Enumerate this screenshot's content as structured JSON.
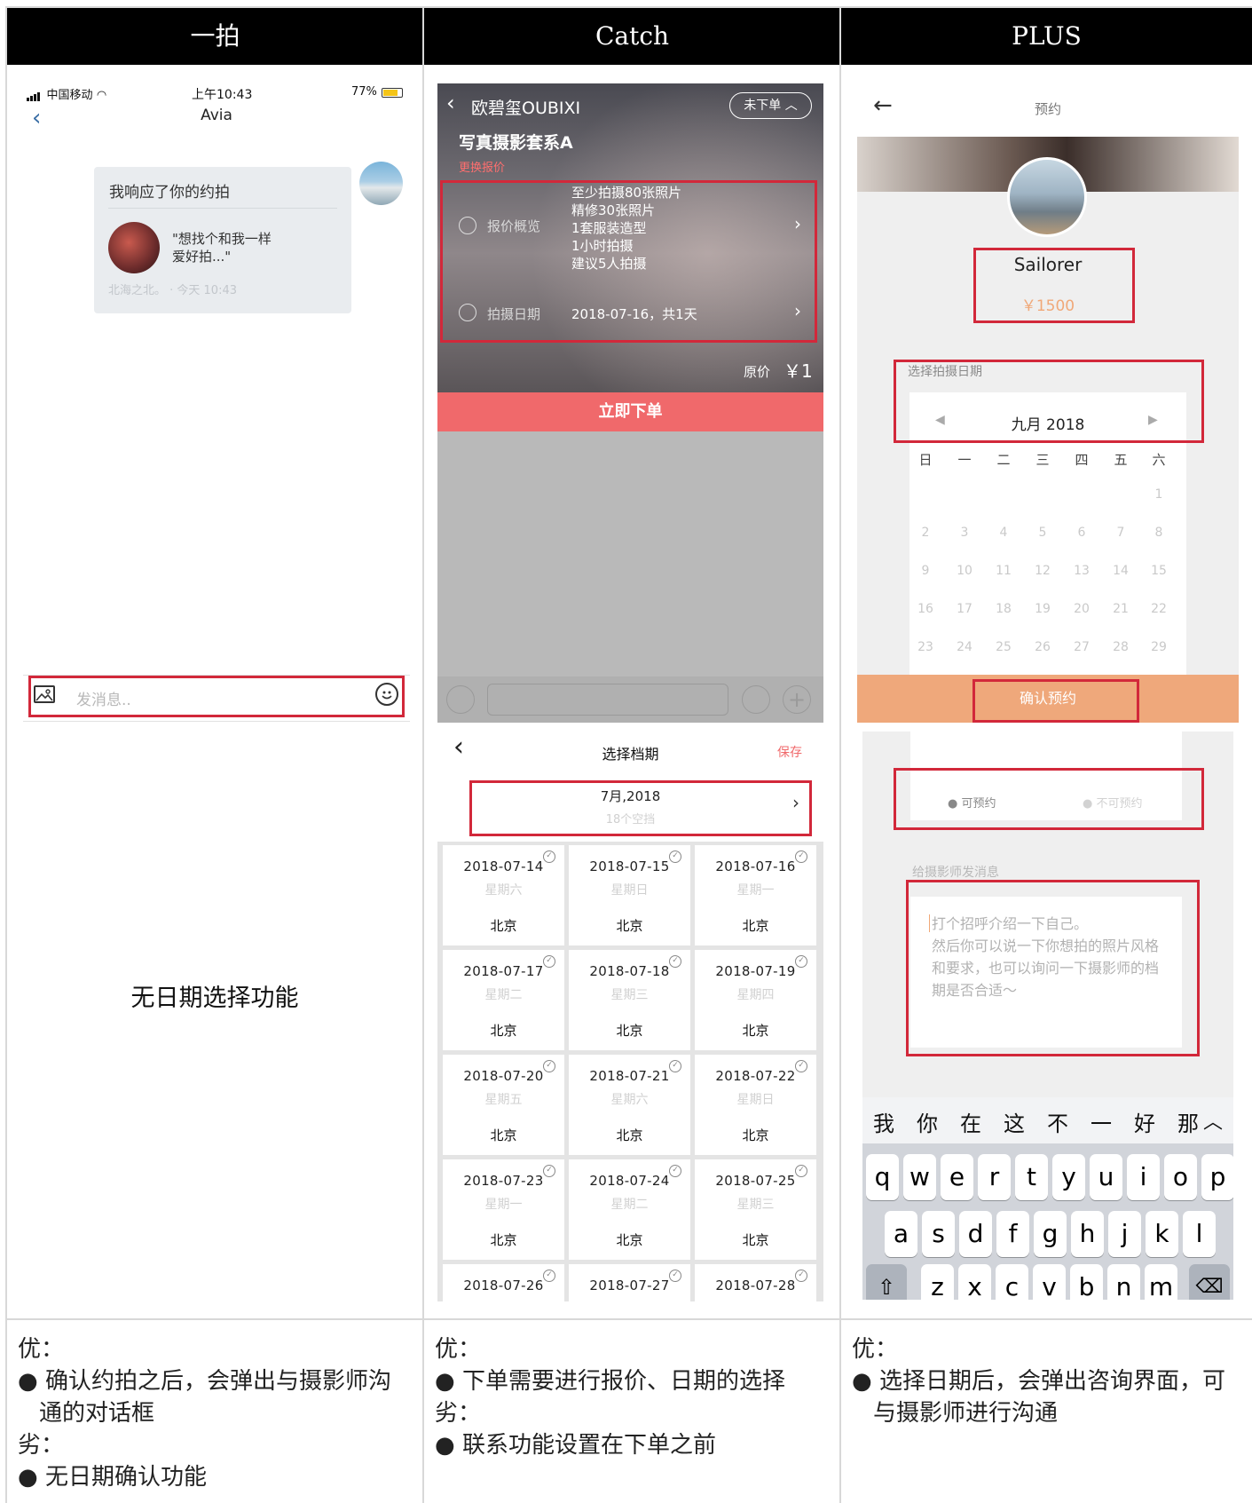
{
  "headers": [
    "一拍",
    "Catch",
    "PLUS"
  ],
  "panel1": {
    "status": {
      "carrier": "中国移动",
      "time": "上午10:43",
      "battery": "77%"
    },
    "nav_title": "Avia",
    "bubble_title": "我响应了你的约拍",
    "card_line1": "\"想找个和我一样",
    "card_line2": "爱好拍...\"",
    "meta": "北海之北。 · 今天 10:43",
    "input_placeholder": "发消息..",
    "no_date_note": "无日期选择功能"
  },
  "panel2": {
    "shop_name": "欧碧玺OUBIXI",
    "order_status": "未下单",
    "package_title": "写真摄影套系A",
    "change_quote": "更换报价",
    "overview_label": "报价概览",
    "overview_lines": [
      "至少拍摄80张照片",
      "精修30张照片",
      "1套服装造型",
      "1小时拍摄",
      "建议5人拍摄"
    ],
    "date_label": "拍摄日期",
    "date_value": "2018-07-16，共1天",
    "price_label": "原价",
    "price_value": "￥1",
    "order_button": "立即下单",
    "schedule_title": "选择档期",
    "save": "保存",
    "month": "7月,2018",
    "free_slots": "18个空挡",
    "dates": [
      {
        "date": "2018-07-14",
        "weekday": "星期六",
        "city": "北京"
      },
      {
        "date": "2018-07-15",
        "weekday": "星期日",
        "city": "北京"
      },
      {
        "date": "2018-07-16",
        "weekday": "星期一",
        "city": "北京"
      },
      {
        "date": "2018-07-17",
        "weekday": "星期二",
        "city": "北京"
      },
      {
        "date": "2018-07-18",
        "weekday": "星期三",
        "city": "北京"
      },
      {
        "date": "2018-07-19",
        "weekday": "星期四",
        "city": "北京"
      },
      {
        "date": "2018-07-20",
        "weekday": "星期五",
        "city": "北京"
      },
      {
        "date": "2018-07-21",
        "weekday": "星期六",
        "city": "北京"
      },
      {
        "date": "2018-07-22",
        "weekday": "星期日",
        "city": "北京"
      },
      {
        "date": "2018-07-23",
        "weekday": "星期一",
        "city": "北京"
      },
      {
        "date": "2018-07-24",
        "weekday": "星期二",
        "city": "北京"
      },
      {
        "date": "2018-07-25",
        "weekday": "星期三",
        "city": "北京"
      },
      {
        "date": "2018-07-26",
        "weekday": "",
        "city": ""
      },
      {
        "date": "2018-07-27",
        "weekday": "",
        "city": ""
      },
      {
        "date": "2018-07-28",
        "weekday": "",
        "city": ""
      }
    ]
  },
  "panel3": {
    "nav_title": "预约",
    "name": "Sailorer",
    "price": "￥1500",
    "select_date_label": "选择拍摄日期",
    "month": "九月 2018",
    "weekdays": [
      "日",
      "一",
      "二",
      "三",
      "四",
      "五",
      "六"
    ],
    "days": [
      "1",
      "2",
      "3",
      "4",
      "5",
      "6",
      "7",
      "8",
      "9",
      "10",
      "11",
      "12",
      "13",
      "14",
      "15",
      "16",
      "17",
      "18",
      "19",
      "20",
      "21",
      "22",
      "23",
      "24",
      "25",
      "26",
      "27",
      "28",
      "29"
    ],
    "confirm_button": "确认预约",
    "available": "可预约",
    "unavailable": "不可预约",
    "message_label": "给摄影师发消息",
    "message_placeholder_lines": [
      "打个招呼介绍一下自己。",
      "然后你可以说一下你想拍的照片风格",
      "和要求，也可以询问一下摄影师的档",
      "期是否合适～"
    ],
    "candidates": [
      "我",
      "你",
      "在",
      "这",
      "不",
      "一",
      "好",
      "那"
    ],
    "keys_row1": [
      "q",
      "w",
      "e",
      "r",
      "t",
      "y",
      "u",
      "i",
      "o",
      "p"
    ],
    "keys_row2": [
      "a",
      "s",
      "d",
      "f",
      "g",
      "h",
      "j",
      "k",
      "l"
    ],
    "keys_row3": [
      "z",
      "x",
      "c",
      "v",
      "b",
      "n",
      "m"
    ]
  },
  "summary": {
    "col1": [
      "优：",
      "● 确认约拍之后，会弹出与摄影师沟",
      "通的对话框",
      "劣：",
      "● 无日期确认功能"
    ],
    "col2": [
      "优：",
      "● 下单需要进行报价、日期的选择",
      "劣：",
      "● 联系功能设置在下单之前"
    ],
    "col3": [
      "优：",
      "● 选择日期后，会弹出咨询界面，可",
      "与摄影师进行沟通"
    ]
  },
  "colors": {
    "red_box": "#d2283a",
    "catch_button": "#f0696b",
    "plus_button": "#efa87b",
    "header_bg": "#000000"
  }
}
